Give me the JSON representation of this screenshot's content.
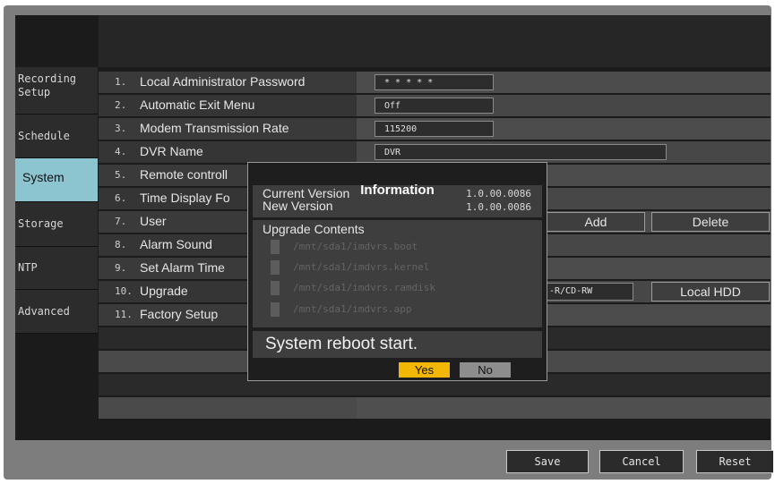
{
  "tabs": [
    {
      "label": "Recording\nSetup",
      "active": false
    },
    {
      "label": "Schedule",
      "active": false
    },
    {
      "label": "System",
      "active": true
    },
    {
      "label": "Storage",
      "active": false
    },
    {
      "label": "NTP",
      "active": false
    },
    {
      "label": "Advanced",
      "active": false
    }
  ],
  "settings": [
    {
      "num": "1.",
      "label": "Local Administrator Password",
      "value": "* * * * *"
    },
    {
      "num": "2.",
      "label": "Automatic Exit Menu",
      "value": "Off"
    },
    {
      "num": "3.",
      "label": "Modem Transmission Rate",
      "value": "115200"
    },
    {
      "num": "4.",
      "label": "DVR Name",
      "value": "DVR"
    },
    {
      "num": "5.",
      "label": "Remote controll",
      "value": ""
    },
    {
      "num": "6.",
      "label": "Time Display Fo",
      "value": ""
    },
    {
      "num": "7.",
      "label": "User",
      "value": ""
    },
    {
      "num": "8.",
      "label": "Alarm Sound",
      "value": ""
    },
    {
      "num": "9.",
      "label": "Set Alarm Time",
      "value": ""
    },
    {
      "num": "10.",
      "label": "Upgrade",
      "value": "-R/CD-RW"
    },
    {
      "num": "11.",
      "label": "Factory Setup",
      "value": ""
    }
  ],
  "user_buttons": {
    "add": "Add",
    "delete": "Delete"
  },
  "upgrade_buttons": {
    "local_hdd": "Local HDD"
  },
  "footer": {
    "save": "Save",
    "cancel": "Cancel",
    "reset": "Reset"
  },
  "dialog": {
    "title": "Information",
    "current_version_label": "Current Version",
    "current_version": "1.0.00.0086",
    "new_version_label": "New Version",
    "new_version": "1.0.00.0086",
    "upgrade_contents_label": "Upgrade Contents",
    "upgrade_items": [
      "/mnt/sda1/imdvrs.boot",
      "/mnt/sda1/imdvrs.kernel",
      "/mnt/sda1/imdvrs.ramdisk",
      "/mnt/sda1/imdvrs.app"
    ],
    "message": "System reboot start.",
    "yes": "Yes",
    "no": "No"
  },
  "colors": {
    "accent": "#8cc4d0",
    "yes_button": "#f2b705",
    "no_button": "#8d8d8d"
  }
}
